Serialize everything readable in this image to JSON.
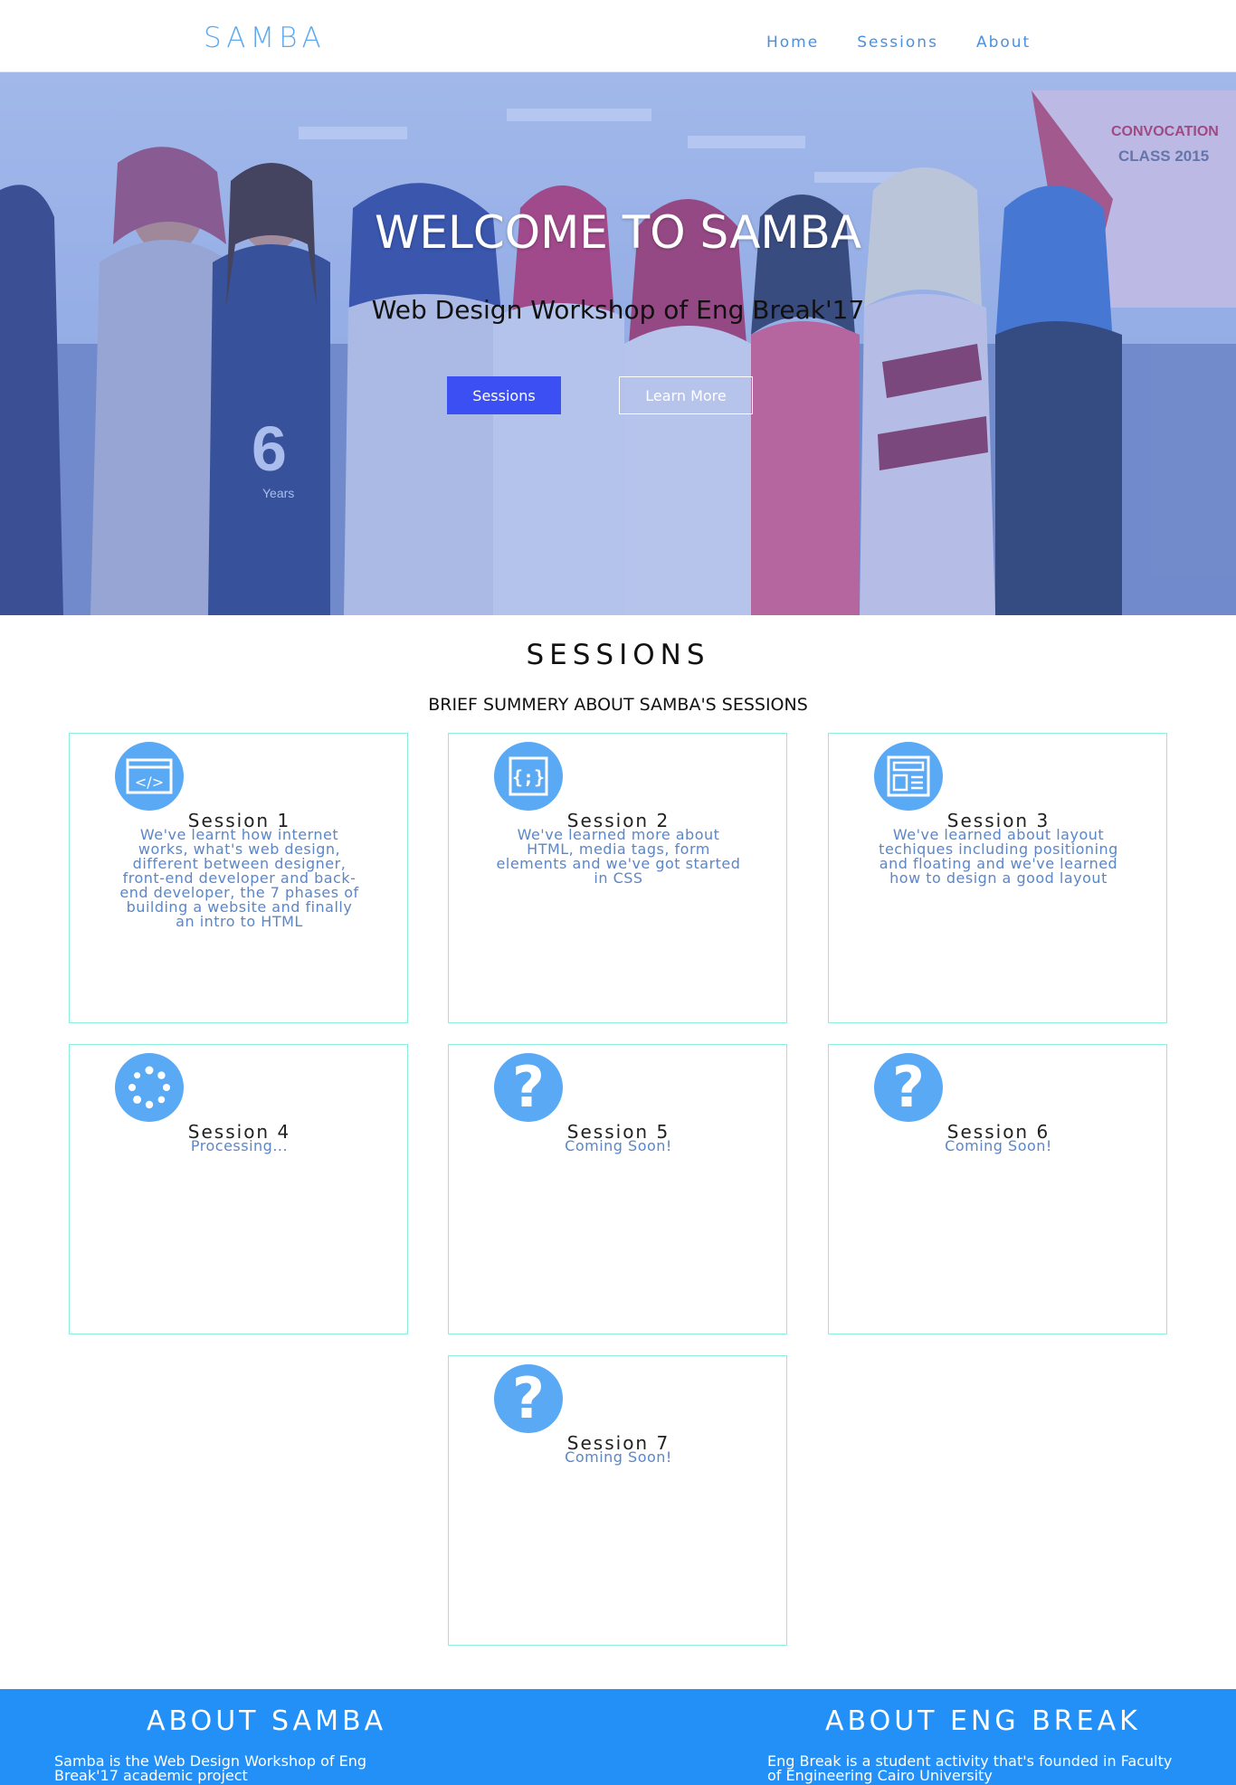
{
  "brand": "SAMBA",
  "nav": {
    "home": "Home",
    "sessions": "Sessions",
    "about": "About"
  },
  "hero": {
    "title": "WELCOME TO SAMBA",
    "subtitle": "Web Design Workshop of Eng Break'17",
    "btn_sessions": "Sessions",
    "btn_learn": "Learn More",
    "image_text_1": "CONVOCATION",
    "image_text_2": "CLASS 2015",
    "image_text_3": "6",
    "image_text_4": "Years"
  },
  "sessions": {
    "title": "SESSIONS",
    "subtitle": "BRIEF SUMMERY ABOUT SAMBA'S SESSIONS",
    "cards": [
      {
        "icon": "code-window-icon",
        "title": "Session 1",
        "desc": "We've learnt how internet works, what's web design, different between designer, front-end developer and back-end developer, the 7 phases of building a website and finally an intro to HTML"
      },
      {
        "icon": "braces-icon",
        "title": "Session 2",
        "desc": "We've learned more about HTML, media tags, form elements and we've got started in CSS"
      },
      {
        "icon": "layout-icon",
        "title": "Session 3",
        "desc": "We've learned about layout techiques including positioning and floating and we've learned how to design a good layout"
      },
      {
        "icon": "spinner-icon",
        "title": "Session 4",
        "desc": "Processing..."
      },
      {
        "icon": "question-icon",
        "title": "Session 5",
        "desc": "Coming Soon!"
      },
      {
        "icon": "question-icon",
        "title": "Session 6",
        "desc": "Coming Soon!"
      },
      {
        "icon": "question-icon",
        "title": "Session 7",
        "desc": "Coming Soon!"
      }
    ]
  },
  "footer": {
    "about_samba_title": "ABOUT SAMBA",
    "about_samba_text": "Samba is the Web Design Workshop of Eng Break'17 academic project",
    "about_eng_title": "ABOUT ENG BREAK",
    "about_eng_text": "Eng Break is a student activity that's founded in Faculty of Engineering Cairo University"
  },
  "colors": {
    "accent": "#5da9ef",
    "button": "#3b4ff2",
    "card_border": "#89f0dc",
    "footer": "#2390f7"
  }
}
